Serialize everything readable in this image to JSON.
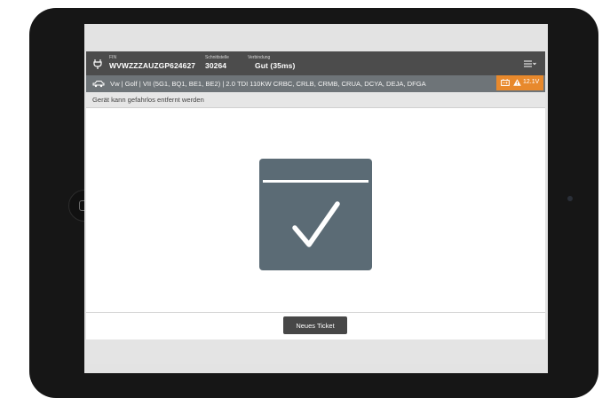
{
  "header": {
    "fin_label": "FIN",
    "fin_value": "WVWZZZAUZGP624627",
    "interface_label": "Schnittstelle",
    "interface_value": "30264",
    "connection_label": "Verbindung",
    "connection_value": "Gut (35ms)"
  },
  "vehicle": {
    "description": "Vw | Golf | VII (5G1, BQ1, BE1, BE2) | 2.0 TDI 110KW CRBC, CRLB, CRMB, CRUA, DCYA, DEJA, DFGA"
  },
  "battery": {
    "voltage": "12.1V",
    "color": "#e8892c"
  },
  "status": {
    "message": "Gerät kann gefahrlos entfernt werden"
  },
  "footer": {
    "new_ticket_label": "Neues Ticket"
  },
  "icons": {
    "plug": "plug-icon",
    "menu": "hamburger-menu-icon",
    "car": "car-icon",
    "battery": "battery-icon",
    "warning": "warning-icon",
    "success": "checkmark-icon"
  },
  "colors": {
    "header_bg": "#4c4c4c",
    "vehicle_bg": "#6e7478",
    "success_bg": "#5b6b75",
    "button_bg": "#474747"
  }
}
